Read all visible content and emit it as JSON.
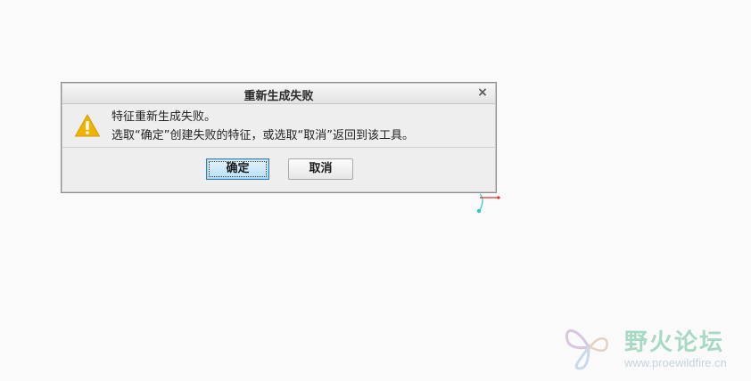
{
  "dialog": {
    "title": "重新生成失败",
    "close_glyph": "×",
    "message_line1": "特征重新生成失败。",
    "message_line2": "选取“确定”创建失败的特征，或选取“取消”返回到该工具。",
    "icon": "warning-icon",
    "ok_label": "确定",
    "cancel_label": "取消"
  },
  "watermark": {
    "logo_text": "野火论坛",
    "url": "www.proewildfire.cn"
  },
  "colors": {
    "background": "#fafafa",
    "dialog_bg": "#eeeeef",
    "warning_yellow": "#f0b400",
    "ok_button": "#b6e0f7",
    "watermark_green": "#a8d9c3"
  }
}
